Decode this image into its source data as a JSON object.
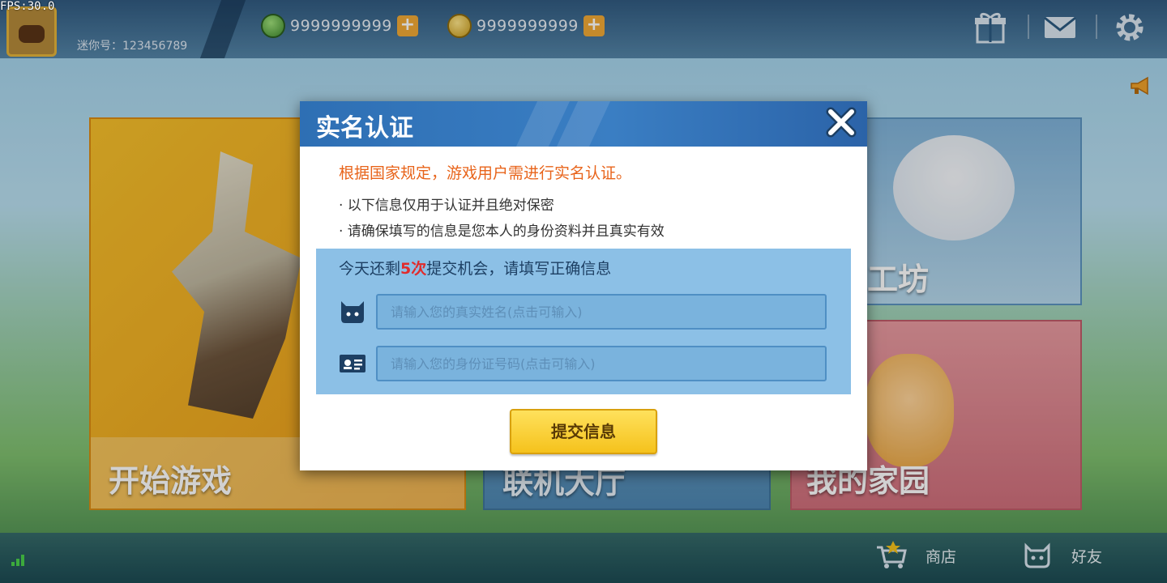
{
  "status": {
    "fps": "FPS:30.0"
  },
  "profile": {
    "uid_label": "迷你号：123456789"
  },
  "currency": [
    {
      "icon": "green-gem-icon",
      "amount": "9999999999"
    },
    {
      "icon": "gold-coin-icon",
      "amount": "9999999999"
    }
  ],
  "header_icons": [
    "gift-icon",
    "mail-icon",
    "settings-gear-icon"
  ],
  "cards": {
    "start_game": "开始游戏",
    "multiplayer": "联机大厅",
    "workshop": "工坊",
    "my_home": "我的家园"
  },
  "bottom_nav": {
    "shop": "商店",
    "friends": "好友"
  },
  "dialog": {
    "title": "实名认证",
    "notice": "根据国家规定，游戏用户需进行实名认证。",
    "bullets": [
      "· 以下信息仅用于认证并且绝对保密",
      "· 请确保填写的信息是您本人的身份资料并且真实有效"
    ],
    "remaining": {
      "prefix": "今天还剩",
      "count": "5次",
      "suffix": "提交机会，请填写正确信息"
    },
    "name_placeholder": "请输入您的真实姓名(点击可输入)",
    "id_placeholder": "请输入您的身份证号码(点击可输入)",
    "submit_label": "提交信息"
  },
  "colors": {
    "dialog_header": "#2e6fb4",
    "notice": "#e8641b",
    "remaining_count": "#e12b2b",
    "submit_button": "#f5c21c"
  }
}
